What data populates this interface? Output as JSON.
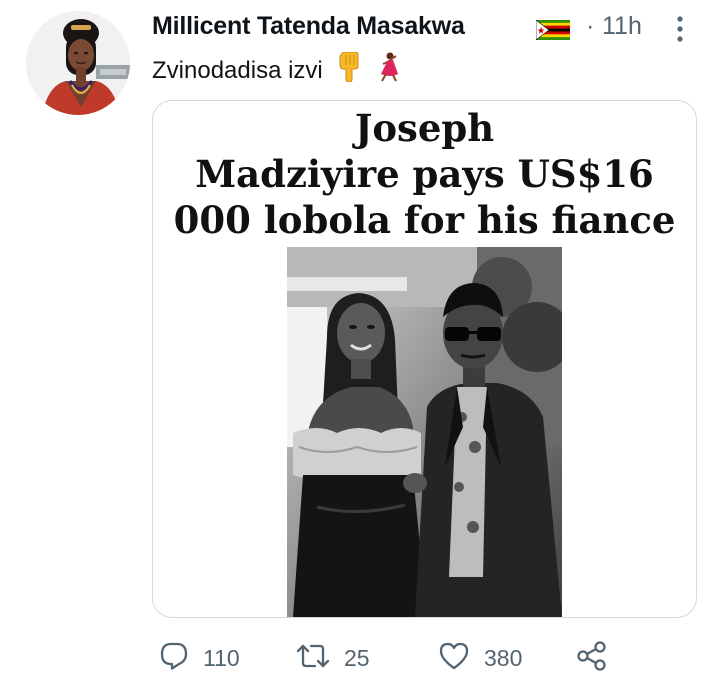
{
  "tweet": {
    "author": {
      "display_name": "Millicent Tatenda Masakwa",
      "flag_icon": "zimbabwe-flag-icon"
    },
    "separator": "·",
    "timestamp": "11h",
    "text": "Zvinodadisa izvi",
    "emojis": [
      "backhand-index-pointing-down-icon",
      "woman-dancing-icon"
    ],
    "media": {
      "headline_lines": [
        "Joseph",
        "Madziyire pays US$16",
        "000 lobola for his fiance"
      ],
      "photo": "black-and-white photo of a couple"
    },
    "actions": {
      "reply_count": "110",
      "retweet_count": "25",
      "like_count": "380"
    }
  },
  "colors": {
    "text_primary": "#0f1419",
    "text_secondary": "#536471",
    "card_border": "#cfd9de"
  }
}
